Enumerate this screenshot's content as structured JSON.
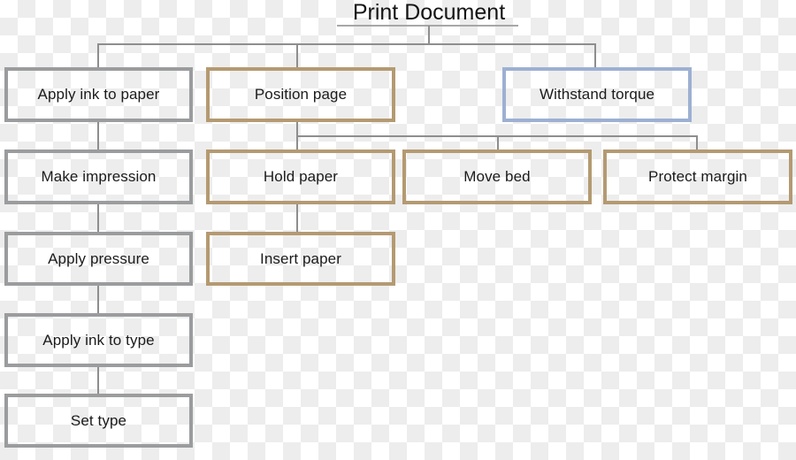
{
  "diagram": {
    "title": "Print Document",
    "type": "objectives-tree",
    "colors": {
      "gray_border": "#9b9c9e",
      "tan_border": "#b49a72",
      "blue_border": "#9db0d2",
      "connector": "#8e8e8e",
      "text": "#1b1b1b",
      "checker_light": "#ffffff",
      "checker_dark": "#ededed"
    },
    "nodes": {
      "apply_ink_to_paper": "Apply ink to paper",
      "position_page": "Position page",
      "withstand_torque": "Withstand torque",
      "make_impression": "Make impression",
      "hold_paper": "Hold paper",
      "move_bed": "Move bed",
      "protect_margin": "Protect margin",
      "apply_pressure": "Apply pressure",
      "insert_paper": "Insert paper",
      "apply_ink_to_type": "Apply ink to type",
      "set_type": "Set type"
    },
    "columns": {
      "level1": [
        "Apply ink to paper",
        "Position page",
        "Withstand torque"
      ],
      "chain_left": [
        "Apply ink to paper",
        "Make impression",
        "Apply pressure",
        "Apply ink to type",
        "Set type"
      ],
      "chain_center": [
        "Position page",
        "Hold paper",
        "Insert paper"
      ],
      "position_page_children": [
        "Hold paper",
        "Move bed",
        "Protect margin"
      ]
    }
  }
}
